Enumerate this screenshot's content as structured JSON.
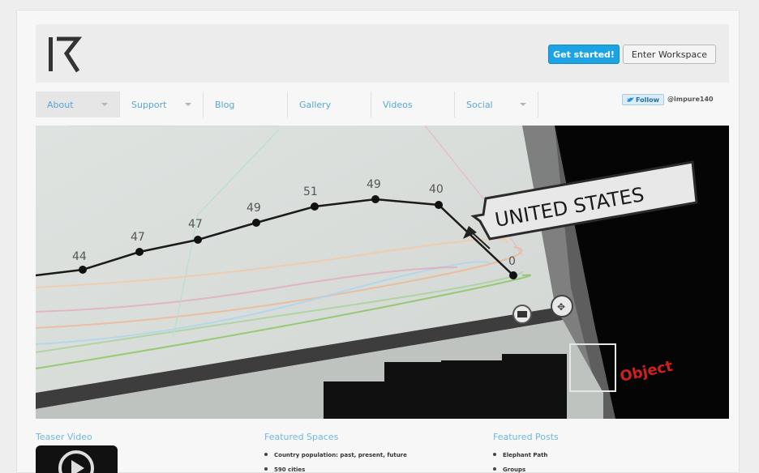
{
  "header": {
    "get_started": "Get started!",
    "enter_workspace": "Enter Workspace"
  },
  "nav": {
    "items": [
      {
        "label": "About",
        "dropdown": true
      },
      {
        "label": "Support",
        "dropdown": true
      },
      {
        "label": "Blog",
        "dropdown": false
      },
      {
        "label": "Gallery",
        "dropdown": false
      },
      {
        "label": "Videos",
        "dropdown": false
      },
      {
        "label": "Social",
        "dropdown": true
      }
    ],
    "follow_label": "Follow",
    "twitter_handle": "@impure140"
  },
  "hero": {
    "callout": "UNITED STATES",
    "object_label": "Object",
    "point_labels": [
      "44",
      "47",
      "47",
      "49",
      "51",
      "49",
      "40",
      "0"
    ]
  },
  "sections": {
    "teaser_video": "Teaser Video",
    "featured_spaces": {
      "title": "Featured Spaces",
      "items": [
        "Country population: past, present, future",
        "590 cities"
      ]
    },
    "featured_posts": {
      "title": "Featured Posts",
      "items": [
        "Elephant Path",
        "Groups"
      ]
    }
  },
  "colors": {
    "accent": "#1ca3e3",
    "nav_text": "#55a7d6",
    "heading": "#6fb8e0",
    "hero_red": "#d0201c"
  }
}
